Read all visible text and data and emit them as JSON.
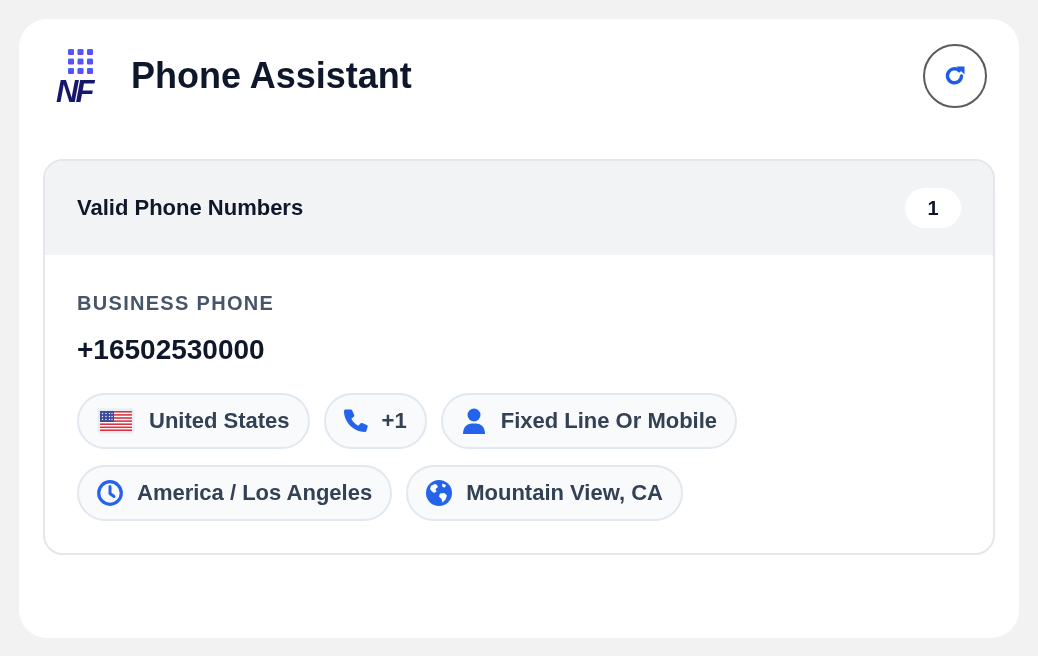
{
  "header": {
    "logo": {
      "text": "NF"
    },
    "title": "Phone Assistant"
  },
  "panel": {
    "title": "Valid Phone Numbers",
    "count": "1",
    "entries": [
      {
        "label": "BUSINESS PHONE",
        "number": "+16502530000",
        "chips": [
          {
            "kind": "country",
            "text": "United States"
          },
          {
            "kind": "dial_code",
            "text": "+1"
          },
          {
            "kind": "line_type",
            "text": "Fixed Line Or Mobile"
          },
          {
            "kind": "timezone",
            "text": "America / Los Angeles"
          },
          {
            "kind": "location",
            "text": "Mountain View, CA"
          }
        ]
      }
    ]
  }
}
